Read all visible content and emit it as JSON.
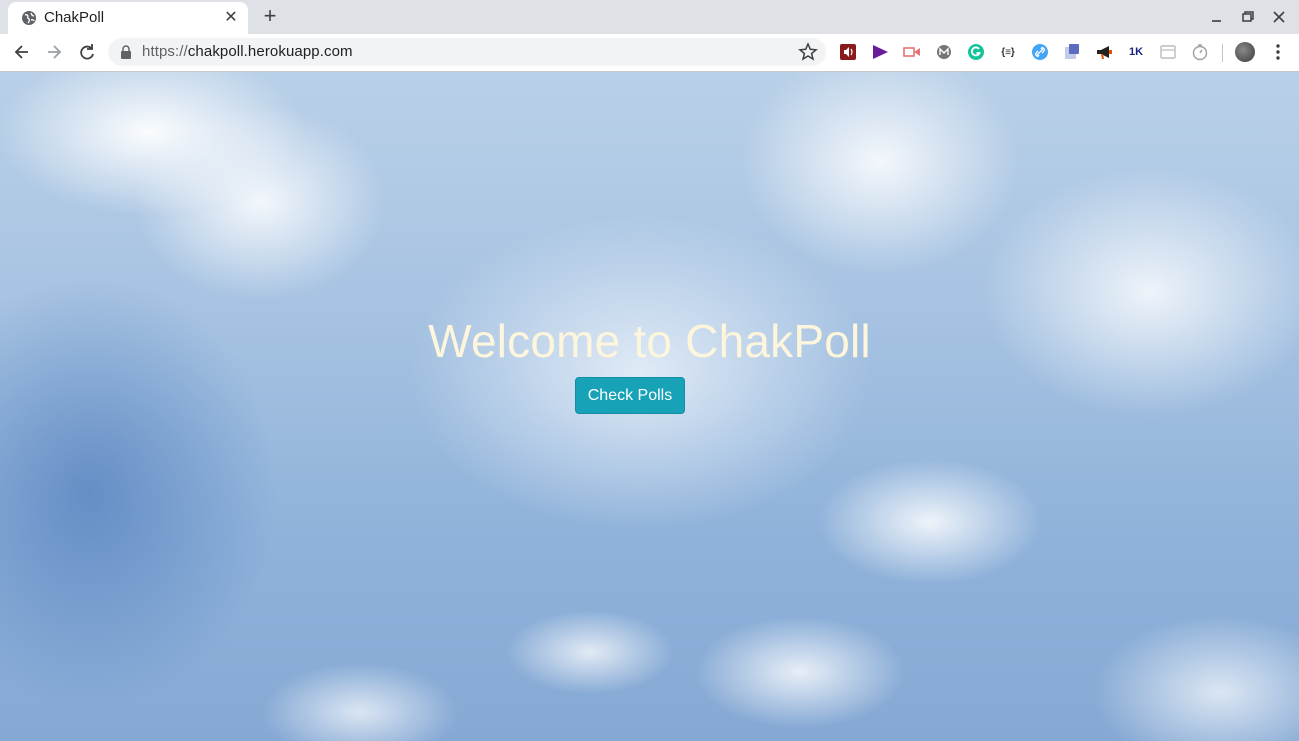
{
  "browser": {
    "tab": {
      "title": "ChakPoll"
    },
    "url": {
      "scheme": "https://",
      "host": "chakpoll.herokuapp.com"
    },
    "extensions": [
      {
        "name": "audio-extension-icon",
        "color": "#8b1a1a"
      },
      {
        "name": "play-extension-icon",
        "color": "#6a1b9a"
      },
      {
        "name": "video-extension-icon",
        "color": "#e57373"
      },
      {
        "name": "m-extension-icon",
        "color": "#757575"
      },
      {
        "name": "grammarly-icon",
        "color": "#15c39a"
      },
      {
        "name": "json-extension-icon",
        "text": "{≡}",
        "color": "#333333"
      },
      {
        "name": "link-extension-icon",
        "color": "#42a5f5"
      },
      {
        "name": "note-extension-icon",
        "color": "#5c6bc0"
      },
      {
        "name": "megaphone-extension-icon",
        "color": "#e65100"
      },
      {
        "name": "1k-extension-icon",
        "text": "1K",
        "color": "#1a237e"
      },
      {
        "name": "window-extension-icon",
        "color": "#bdbdbd"
      },
      {
        "name": "timer-extension-icon",
        "color": "#9e9e9e"
      }
    ]
  },
  "page": {
    "title": "Welcome to ChakPoll",
    "cta_label": "Check Polls",
    "colors": {
      "title": "#fdf5dc",
      "button": "#17a2b8"
    }
  }
}
